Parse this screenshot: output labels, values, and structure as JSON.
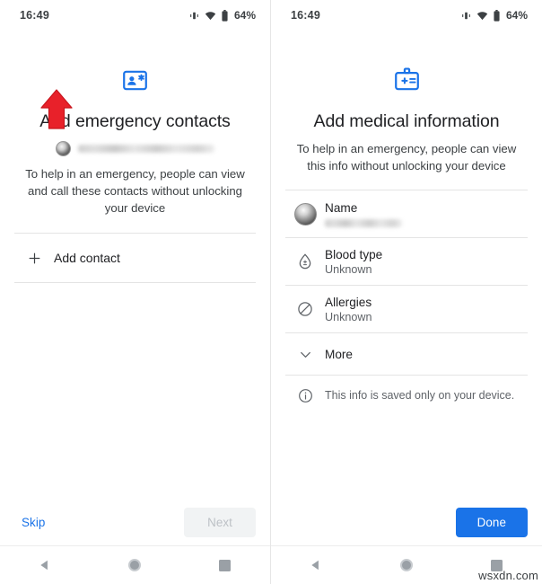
{
  "statusbar": {
    "time": "16:49",
    "battery_percent": "64%",
    "icons": [
      "vibrate-icon",
      "wifi-icon",
      "battery-icon"
    ]
  },
  "left_screen": {
    "header_icon": "emergency-contact-card-icon",
    "title": "Add emergency contacts",
    "account": {
      "avatar": "account-avatar",
      "email_redacted": ""
    },
    "description": "To help in an emergency, people can view and call these contacts without unlocking your device",
    "add_contact": {
      "icon": "plus-icon",
      "label": "Add contact"
    },
    "annotation": {
      "shape": "red-up-arrow",
      "color": "#e8212a"
    },
    "buttons": {
      "skip_label": "Skip",
      "next_label": "Next",
      "next_enabled": false,
      "skip_color": "#1a73e8"
    }
  },
  "right_screen": {
    "header_icon": "medical-id-badge-icon",
    "title": "Add medical information",
    "description": "To help in an emergency, people can view this info without unlocking your device",
    "rows": [
      {
        "icon": "account-avatar",
        "title": "Name",
        "value": "",
        "value_redacted": true
      },
      {
        "icon": "blood-drop-icon",
        "title": "Blood type",
        "value": "Unknown",
        "value_redacted": false
      },
      {
        "icon": "allergies-block-icon",
        "title": "Allergies",
        "value": "Unknown",
        "value_redacted": false
      },
      {
        "icon": "chevron-down-icon",
        "title": "More",
        "value": "",
        "value_redacted": false
      }
    ],
    "footer_note": {
      "icon": "info-icon",
      "text": "This info is saved only on your device."
    },
    "buttons": {
      "done_label": "Done",
      "done_color": "#1a73e8"
    }
  },
  "navbar": {
    "back": "back-triangle-icon",
    "home": "home-circle-icon",
    "recents": "recents-square-icon"
  },
  "watermark": "wsxdn.com",
  "colors": {
    "accent_blue": "#1a73e8",
    "icon_blue": "#1a73e8",
    "text_primary": "#202124",
    "text_secondary": "#5f6368",
    "divider": "#e4e4e4",
    "annotation_red": "#e8212a"
  }
}
